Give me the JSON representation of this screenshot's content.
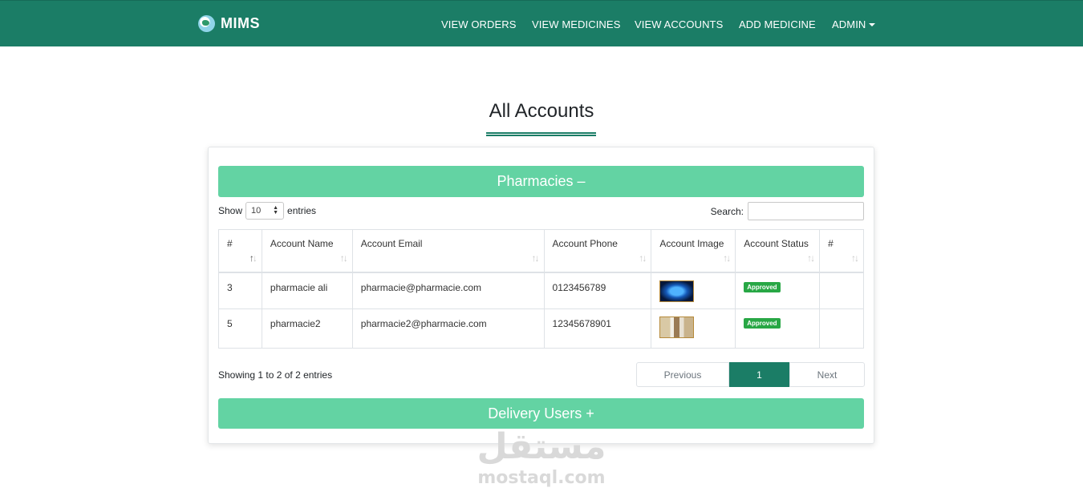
{
  "brand": {
    "name": "MIMS",
    "logo_icon": "globe-icon"
  },
  "nav": {
    "items": [
      {
        "label": "VIEW ORDERS"
      },
      {
        "label": "VIEW MEDICINES"
      },
      {
        "label": "VIEW ACCOUNTS"
      },
      {
        "label": "ADD MEDICINE"
      },
      {
        "label": "ADMIN"
      }
    ]
  },
  "page": {
    "title": "All Accounts"
  },
  "pharmacies": {
    "title": "Pharmacies –",
    "show_label": "Show",
    "entries_value": "10",
    "entries_label": "entries",
    "search_label": "Search:",
    "search_value": "",
    "columns": [
      "#",
      "Account Name",
      "Account Email",
      "Account Phone",
      "Account Image",
      "Account Status",
      "#"
    ],
    "rows": [
      {
        "id": "3",
        "name": "pharmacie ali",
        "email": "pharmacie@pharmacie.com",
        "phone": "0123456789",
        "image": "brain-image",
        "status": "Approved"
      },
      {
        "id": "5",
        "name": "pharmacie2",
        "email": "pharmacie2@pharmacie.com",
        "phone": "12345678901",
        "image": "pharmacy-image",
        "status": "Approved"
      }
    ],
    "info": "Showing 1 to 2 of 2 entries",
    "pagination": {
      "previous": "Previous",
      "current": "1",
      "next": "Next"
    }
  },
  "delivery": {
    "title": "Delivery Users +"
  },
  "watermark": {
    "arabic": "مستقل",
    "latin": "mostaql.com"
  },
  "colors": {
    "primary": "#1b7d66",
    "accent": "#63d3a3",
    "badge": "#28a745"
  }
}
